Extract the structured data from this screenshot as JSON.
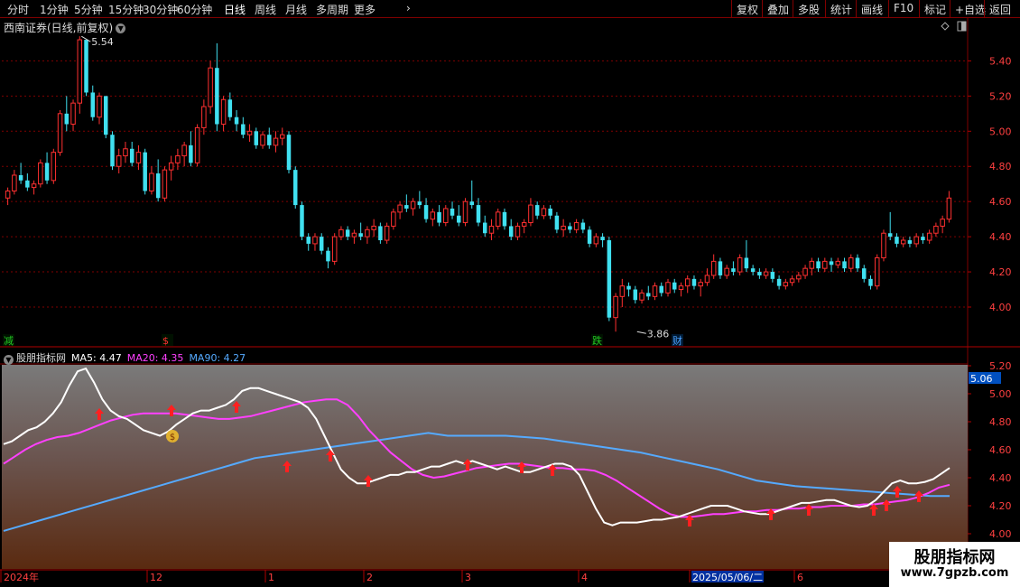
{
  "toolbar": {
    "left_items": [
      "分时",
      "1分钟",
      "5分钟",
      "15分钟",
      "30分钟",
      "60分钟",
      "日线",
      "周线",
      "月线",
      "多周期",
      "更多"
    ],
    "active_item": "日线",
    "more_chevron": "chevron-right-icon",
    "right_items": [
      "复权",
      "叠加",
      "多股",
      "统计",
      "画线",
      "F10",
      "标记",
      "+自选",
      "返回"
    ]
  },
  "main_chart": {
    "title": "西南证券(日线,前复权)",
    "title_dropdown_icon": "chevron-down-icon",
    "y_ticks": [
      "5.40",
      "5.20",
      "5.00",
      "4.80",
      "4.60",
      "4.40",
      "4.20",
      "4.00"
    ],
    "high_label": "5.54",
    "low_label": "3.86",
    "markers": [
      {
        "text": "减",
        "color": "#22cc22"
      },
      {
        "text": "$",
        "color": "#ff3030"
      },
      {
        "text": "跌",
        "color": "#22cc22"
      },
      {
        "text": "财",
        "color": "#4aa0ff"
      }
    ],
    "top_right_icons": [
      "diamond-icon",
      "panel-toggle-icon"
    ],
    "colors": {
      "up": "#ff3030",
      "down": "#40e0f0",
      "grid": "#800000"
    }
  },
  "indicator": {
    "title": "股朋指标网",
    "ma5_label": "MA5: 4.47",
    "ma20_label": "MA20: 4.35",
    "ma90_label": "MA90: 4.27",
    "y_ticks": [
      "5.20",
      "5.00",
      "4.80",
      "4.60",
      "4.40",
      "4.20",
      "4.00"
    ],
    "current_value": "5.06",
    "colors": {
      "ma5": "#ffffff",
      "ma20": "#ff40ff",
      "ma90": "#55aaff",
      "arrow": "#ff2020"
    }
  },
  "x_axis": {
    "labels": [
      "2024年",
      "12",
      "1",
      "2",
      "3",
      "4",
      "2025/05/06/二",
      "6"
    ]
  },
  "watermark": {
    "name": "股朋指标网",
    "url": "www.7gpzb.com"
  },
  "chart_data": {
    "type": "candlestick",
    "y_range": [
      3.86,
      5.54
    ],
    "indicator_y_range": [
      4.0,
      5.2
    ],
    "ohlc": [
      [
        4.62,
        4.68,
        4.58,
        4.66
      ],
      [
        4.66,
        4.78,
        4.64,
        4.75
      ],
      [
        4.75,
        4.82,
        4.7,
        4.72
      ],
      [
        4.72,
        4.76,
        4.66,
        4.68
      ],
      [
        4.68,
        4.72,
        4.64,
        4.7
      ],
      [
        4.7,
        4.84,
        4.68,
        4.82
      ],
      [
        4.82,
        4.88,
        4.7,
        4.72
      ],
      [
        4.72,
        4.9,
        4.7,
        4.88
      ],
      [
        4.88,
        5.12,
        4.86,
        5.1
      ],
      [
        5.1,
        5.2,
        5.0,
        5.04
      ],
      [
        5.04,
        5.18,
        5.0,
        5.16
      ],
      [
        5.16,
        5.54,
        5.1,
        5.52
      ],
      [
        5.52,
        5.48,
        5.2,
        5.22
      ],
      [
        5.22,
        5.26,
        5.06,
        5.08
      ],
      [
        5.08,
        5.22,
        5.04,
        5.2
      ],
      [
        5.2,
        5.2,
        4.96,
        4.98
      ],
      [
        4.98,
        5.0,
        4.78,
        4.8
      ],
      [
        4.8,
        4.9,
        4.76,
        4.86
      ],
      [
        4.86,
        4.94,
        4.82,
        4.9
      ],
      [
        4.9,
        4.94,
        4.8,
        4.82
      ],
      [
        4.82,
        4.92,
        4.78,
        4.88
      ],
      [
        4.88,
        4.9,
        4.64,
        4.66
      ],
      [
        4.66,
        4.8,
        4.64,
        4.76
      ],
      [
        4.76,
        4.84,
        4.6,
        4.62
      ],
      [
        4.62,
        4.8,
        4.6,
        4.78
      ],
      [
        4.78,
        4.86,
        4.72,
        4.82
      ],
      [
        4.82,
        4.9,
        4.78,
        4.86
      ],
      [
        4.86,
        4.94,
        4.8,
        4.92
      ],
      [
        4.92,
        5.0,
        4.8,
        4.82
      ],
      [
        4.82,
        5.04,
        4.8,
        5.02
      ],
      [
        5.02,
        5.18,
        4.98,
        5.14
      ],
      [
        5.14,
        5.4,
        5.1,
        5.36
      ],
      [
        5.36,
        5.5,
        5.0,
        5.04
      ],
      [
        5.04,
        5.2,
        5.0,
        5.18
      ],
      [
        5.18,
        5.22,
        5.06,
        5.08
      ],
      [
        5.08,
        5.12,
        5.0,
        5.04
      ],
      [
        5.04,
        5.08,
        4.96,
        4.98
      ],
      [
        4.98,
        5.04,
        4.94,
        5.0
      ],
      [
        5.0,
        5.02,
        4.9,
        4.92
      ],
      [
        4.92,
        5.0,
        4.9,
        4.98
      ],
      [
        4.98,
        5.02,
        4.9,
        4.92
      ],
      [
        4.92,
        5.0,
        4.88,
        4.96
      ],
      [
        4.96,
        5.02,
        4.92,
        4.98
      ],
      [
        4.98,
        5.0,
        4.76,
        4.78
      ],
      [
        4.78,
        4.8,
        4.56,
        4.58
      ],
      [
        4.58,
        4.6,
        4.38,
        4.4
      ],
      [
        4.4,
        4.42,
        4.32,
        4.36
      ],
      [
        4.36,
        4.42,
        4.32,
        4.4
      ],
      [
        4.4,
        4.42,
        4.3,
        4.32
      ],
      [
        4.32,
        4.34,
        4.22,
        4.26
      ],
      [
        4.26,
        4.42,
        4.24,
        4.4
      ],
      [
        4.4,
        4.46,
        4.38,
        4.44
      ],
      [
        4.44,
        4.46,
        4.38,
        4.4
      ],
      [
        4.4,
        4.44,
        4.36,
        4.42
      ],
      [
        4.42,
        4.48,
        4.38,
        4.4
      ],
      [
        4.4,
        4.46,
        4.36,
        4.44
      ],
      [
        4.44,
        4.5,
        4.4,
        4.46
      ],
      [
        4.46,
        4.48,
        4.36,
        4.38
      ],
      [
        4.38,
        4.48,
        4.36,
        4.46
      ],
      [
        4.46,
        4.56,
        4.44,
        4.54
      ],
      [
        4.54,
        4.6,
        4.5,
        4.58
      ],
      [
        4.58,
        4.64,
        4.54,
        4.56
      ],
      [
        4.56,
        4.62,
        4.52,
        4.6
      ],
      [
        4.6,
        4.66,
        4.56,
        4.58
      ],
      [
        4.58,
        4.62,
        4.48,
        4.5
      ],
      [
        4.5,
        4.56,
        4.46,
        4.54
      ],
      [
        4.54,
        4.58,
        4.46,
        4.48
      ],
      [
        4.48,
        4.58,
        4.46,
        4.56
      ],
      [
        4.56,
        4.6,
        4.5,
        4.52
      ],
      [
        4.52,
        4.58,
        4.46,
        4.48
      ],
      [
        4.48,
        4.62,
        4.46,
        4.6
      ],
      [
        4.6,
        4.72,
        4.56,
        4.58
      ],
      [
        4.58,
        4.62,
        4.46,
        4.48
      ],
      [
        4.48,
        4.52,
        4.4,
        4.42
      ],
      [
        4.42,
        4.5,
        4.38,
        4.46
      ],
      [
        4.46,
        4.56,
        4.44,
        4.54
      ],
      [
        4.54,
        4.56,
        4.44,
        4.46
      ],
      [
        4.46,
        4.5,
        4.38,
        4.4
      ],
      [
        4.4,
        4.48,
        4.38,
        4.46
      ],
      [
        4.46,
        4.5,
        4.42,
        4.48
      ],
      [
        4.48,
        4.62,
        4.46,
        4.58
      ],
      [
        4.58,
        4.6,
        4.5,
        4.52
      ],
      [
        4.52,
        4.58,
        4.5,
        4.56
      ],
      [
        4.56,
        4.58,
        4.5,
        4.52
      ],
      [
        4.52,
        4.54,
        4.42,
        4.44
      ],
      [
        4.44,
        4.5,
        4.4,
        4.46
      ],
      [
        4.46,
        4.48,
        4.42,
        4.44
      ],
      [
        4.44,
        4.5,
        4.42,
        4.48
      ],
      [
        4.48,
        4.5,
        4.42,
        4.44
      ],
      [
        4.44,
        4.46,
        4.34,
        4.36
      ],
      [
        4.36,
        4.42,
        4.34,
        4.4
      ],
      [
        4.4,
        4.42,
        4.34,
        4.38
      ],
      [
        4.38,
        4.4,
        3.92,
        3.94
      ],
      [
        3.94,
        4.08,
        3.86,
        4.06
      ],
      [
        4.06,
        4.16,
        4.0,
        4.12
      ],
      [
        4.12,
        4.14,
        4.06,
        4.1
      ],
      [
        4.1,
        4.12,
        4.02,
        4.04
      ],
      [
        4.04,
        4.1,
        4.02,
        4.08
      ],
      [
        4.08,
        4.12,
        4.04,
        4.06
      ],
      [
        4.06,
        4.14,
        4.04,
        4.12
      ],
      [
        4.12,
        4.14,
        4.06,
        4.08
      ],
      [
        4.08,
        4.16,
        4.06,
        4.14
      ],
      [
        4.14,
        4.16,
        4.08,
        4.1
      ],
      [
        4.1,
        4.14,
        4.06,
        4.12
      ],
      [
        4.12,
        4.18,
        4.08,
        4.16
      ],
      [
        4.16,
        4.18,
        4.1,
        4.12
      ],
      [
        4.12,
        4.16,
        4.06,
        4.14
      ],
      [
        4.14,
        4.22,
        4.12,
        4.18
      ],
      [
        4.18,
        4.3,
        4.16,
        4.26
      ],
      [
        4.26,
        4.28,
        4.16,
        4.18
      ],
      [
        4.18,
        4.24,
        4.16,
        4.22
      ],
      [
        4.22,
        4.26,
        4.18,
        4.2
      ],
      [
        4.2,
        4.3,
        4.18,
        4.28
      ],
      [
        4.28,
        4.38,
        4.2,
        4.22
      ],
      [
        4.22,
        4.24,
        4.18,
        4.2
      ],
      [
        4.2,
        4.22,
        4.16,
        4.18
      ],
      [
        4.18,
        4.22,
        4.16,
        4.2
      ],
      [
        4.2,
        4.22,
        4.14,
        4.16
      ],
      [
        4.16,
        4.18,
        4.1,
        4.12
      ],
      [
        4.12,
        4.16,
        4.1,
        4.14
      ],
      [
        4.14,
        4.18,
        4.12,
        4.16
      ],
      [
        4.16,
        4.2,
        4.14,
        4.18
      ],
      [
        4.18,
        4.24,
        4.16,
        4.22
      ],
      [
        4.22,
        4.28,
        4.18,
        4.26
      ],
      [
        4.26,
        4.28,
        4.2,
        4.22
      ],
      [
        4.22,
        4.28,
        4.2,
        4.26
      ],
      [
        4.26,
        4.28,
        4.2,
        4.24
      ],
      [
        4.24,
        4.28,
        4.22,
        4.26
      ],
      [
        4.26,
        4.28,
        4.2,
        4.22
      ],
      [
        4.22,
        4.3,
        4.2,
        4.28
      ],
      [
        4.28,
        4.3,
        4.2,
        4.22
      ],
      [
        4.22,
        4.24,
        4.14,
        4.16
      ],
      [
        4.16,
        4.18,
        4.1,
        4.12
      ],
      [
        4.12,
        4.3,
        4.1,
        4.28
      ],
      [
        4.28,
        4.44,
        4.26,
        4.42
      ],
      [
        4.42,
        4.54,
        4.38,
        4.4
      ],
      [
        4.4,
        4.42,
        4.34,
        4.36
      ],
      [
        4.36,
        4.4,
        4.34,
        4.38
      ],
      [
        4.38,
        4.4,
        4.34,
        4.36
      ],
      [
        4.36,
        4.42,
        4.34,
        4.4
      ],
      [
        4.4,
        4.42,
        4.36,
        4.38
      ],
      [
        4.38,
        4.44,
        4.36,
        4.42
      ],
      [
        4.42,
        4.48,
        4.4,
        4.46
      ],
      [
        4.46,
        4.52,
        4.42,
        4.5
      ],
      [
        4.5,
        4.66,
        4.48,
        4.62
      ]
    ],
    "series": [
      {
        "name": "MA5",
        "values": [
          4.64,
          4.66,
          4.7,
          4.74,
          4.76,
          4.8,
          4.86,
          4.94,
          5.06,
          5.16,
          5.18,
          5.08,
          4.96,
          4.88,
          4.84,
          4.82,
          4.78,
          4.74,
          4.72,
          4.7,
          4.73,
          4.78,
          4.82,
          4.86,
          4.88,
          4.88,
          4.9,
          4.92,
          4.96,
          5.02,
          5.04,
          5.04,
          5.02,
          5.0,
          4.98,
          4.96,
          4.94,
          4.9,
          4.82,
          4.7,
          4.58,
          4.46,
          4.4,
          4.36,
          4.36,
          4.38,
          4.4,
          4.42,
          4.42,
          4.44,
          4.44,
          4.46,
          4.48,
          4.48,
          4.5,
          4.52,
          4.5,
          4.52,
          4.5,
          4.48,
          4.46,
          4.48,
          4.46,
          4.44,
          4.44,
          4.46,
          4.48,
          4.5,
          4.5,
          4.48,
          4.42,
          4.3,
          4.18,
          4.08,
          4.06,
          4.08,
          4.08,
          4.08,
          4.09,
          4.1,
          4.1,
          4.11,
          4.12,
          4.14,
          4.16,
          4.18,
          4.2,
          4.2,
          4.2,
          4.18,
          4.16,
          4.15,
          4.14,
          4.14,
          4.16,
          4.18,
          4.2,
          4.22,
          4.22,
          4.23,
          4.24,
          4.24,
          4.22,
          4.2,
          4.19,
          4.2,
          4.24,
          4.3,
          4.36,
          4.38,
          4.36,
          4.36,
          4.37,
          4.39,
          4.43,
          4.47
        ]
      },
      {
        "name": "MA20",
        "values": [
          4.5,
          4.55,
          4.6,
          4.64,
          4.67,
          4.69,
          4.7,
          4.72,
          4.75,
          4.78,
          4.81,
          4.83,
          4.85,
          4.86,
          4.86,
          4.86,
          4.86,
          4.85,
          4.84,
          4.83,
          4.82,
          4.82,
          4.83,
          4.84,
          4.86,
          4.88,
          4.9,
          4.92,
          4.94,
          4.95,
          4.96,
          4.96,
          4.92,
          4.84,
          4.74,
          4.66,
          4.58,
          4.52,
          4.46,
          4.42,
          4.4,
          4.41,
          4.43,
          4.45,
          4.47,
          4.48,
          4.49,
          4.5,
          4.5,
          4.49,
          4.48,
          4.47,
          4.47,
          4.46,
          4.46,
          4.45,
          4.42,
          4.38,
          4.33,
          4.28,
          4.23,
          4.18,
          4.14,
          4.12,
          4.12,
          4.13,
          4.14,
          4.14,
          4.15,
          4.16,
          4.16,
          4.17,
          4.17,
          4.18,
          4.18,
          4.19,
          4.19,
          4.2,
          4.2,
          4.2,
          4.21,
          4.21,
          4.22,
          4.23,
          4.24,
          4.26,
          4.29,
          4.33,
          4.35
        ]
      },
      {
        "name": "MA90",
        "values": [
          4.02,
          4.06,
          4.1,
          4.14,
          4.18,
          4.22,
          4.26,
          4.3,
          4.34,
          4.38,
          4.42,
          4.46,
          4.5,
          4.54,
          4.56,
          4.58,
          4.6,
          4.62,
          4.64,
          4.66,
          4.68,
          4.7,
          4.72,
          4.7,
          4.7,
          4.7,
          4.7,
          4.69,
          4.68,
          4.66,
          4.64,
          4.62,
          4.6,
          4.58,
          4.55,
          4.52,
          4.49,
          4.46,
          4.42,
          4.38,
          4.36,
          4.34,
          4.33,
          4.32,
          4.31,
          4.3,
          4.29,
          4.28,
          4.27,
          4.27
        ]
      }
    ]
  }
}
